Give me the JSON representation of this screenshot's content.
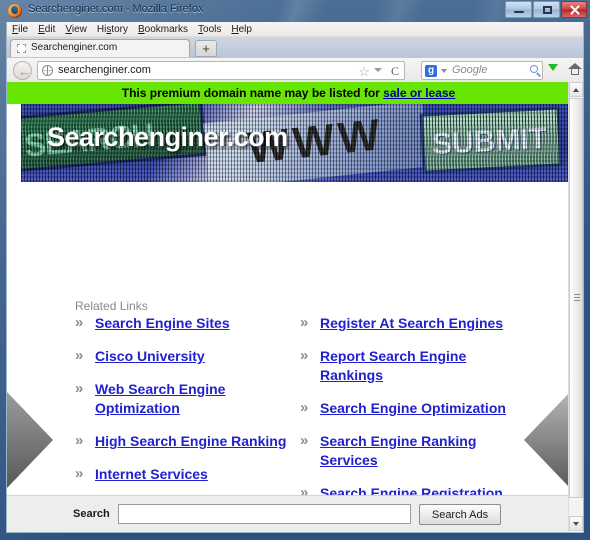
{
  "window": {
    "title": "Searchenginer.com - Mozilla Firefox",
    "minimize_label": "Minimize",
    "maximize_label": "Maximize",
    "close_label": "Close"
  },
  "menubar": {
    "items": [
      {
        "label": "File",
        "accel": "F"
      },
      {
        "label": "Edit",
        "accel": "E"
      },
      {
        "label": "View",
        "accel": "V"
      },
      {
        "label": "History",
        "accel": "s"
      },
      {
        "label": "Bookmarks",
        "accel": "B"
      },
      {
        "label": "Tools",
        "accel": "T"
      },
      {
        "label": "Help",
        "accel": "H"
      }
    ]
  },
  "tabs": {
    "active_tab_label": "Searchenginer.com",
    "new_tab_label": "+"
  },
  "toolbar": {
    "back_glyph": "←",
    "url_value": "searchenginer.com",
    "star_glyph": "☆",
    "reload_glyph": "C",
    "search_engine_letter": "g",
    "search_placeholder": "Google",
    "download_label": "Downloads",
    "home_label": "Home"
  },
  "page": {
    "notice": {
      "text_before": "This premium domain name may be listed for ",
      "link_text": "sale or lease",
      "background_color": "#66e600",
      "link_color": "#00009c"
    },
    "banner": {
      "title": "Searchenginer.com",
      "graphic_search_word": "SEARCH",
      "graphic_www_word": "WWW",
      "graphic_submit_word": "SUBMIT"
    },
    "related_links_label": "Related Links",
    "bullet_glyph": "»",
    "links_left": [
      "Search Engine Sites",
      "Cisco University",
      "Web Search Engine Optimization",
      "High Search Engine Ranking",
      "Internet Services"
    ],
    "links_right": [
      "Register At Search Engines",
      "Report Search Engine Rankings",
      "Search Engine Optimization",
      "Search Engine Ranking Services",
      "Search Engine Registration"
    ],
    "link_color": "#2121cf",
    "footer": {
      "search_label": "Search",
      "search_value": "",
      "search_placeholder": "",
      "button_label": "Search Ads"
    }
  }
}
